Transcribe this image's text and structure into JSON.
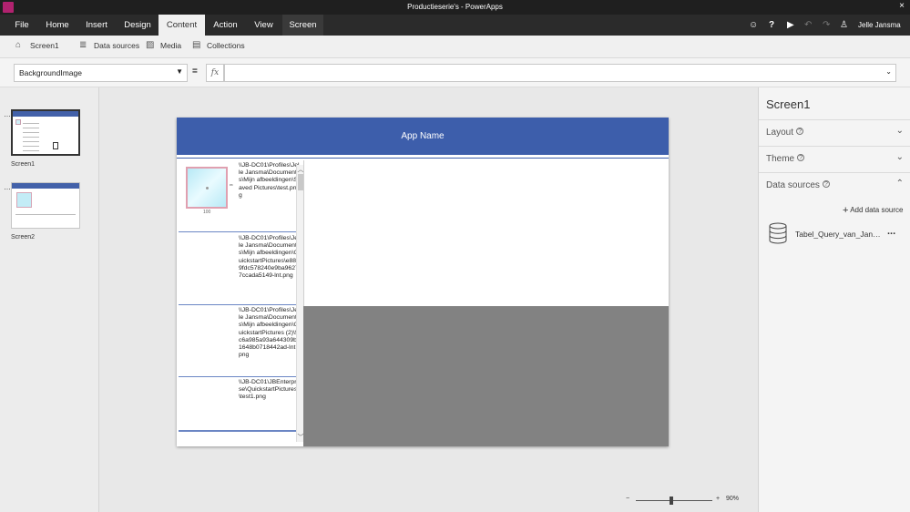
{
  "window": {
    "title": "Productieserie's - PowerApps",
    "close_glyph": "×"
  },
  "menu": {
    "tabs": [
      {
        "label": "File"
      },
      {
        "label": "Home"
      },
      {
        "label": "Insert"
      },
      {
        "label": "Design"
      },
      {
        "label": "Content"
      },
      {
        "label": "Action"
      },
      {
        "label": "View"
      },
      {
        "label": "Screen"
      }
    ],
    "active_tab": "Content",
    "user_name": "Jelle Jansma"
  },
  "subtoolbar": {
    "screen_label": "Screen1",
    "data_sources_label": "Data sources",
    "media_label": "Media",
    "collections_label": "Collections"
  },
  "propbar": {
    "property": "BackgroundImage",
    "equals": "=",
    "fx": "fx",
    "formula": ""
  },
  "screens": [
    {
      "label": "Screen1",
      "selected": true
    },
    {
      "label": "Screen2",
      "selected": false
    }
  ],
  "app": {
    "header_title": "App Name",
    "gallery_items": [
      {
        "path": "\\\\JB-DC01\\Profiles\\Jelle Jansma\\Documents\\Mijn afbeeldingen\\Saved Pictures\\test.png"
      },
      {
        "path": "\\\\JB-DC01\\Profiles\\Jelle Jansma\\Documents\\Mijn afbeeldingen\\QuickstartPictures\\e8809fdc578240e9ba96277ccada5149-lnt.png"
      },
      {
        "path": "\\\\JB-DC01\\Profiles\\Jelle Jansma\\Documents\\Mijn afbeeldingen\\QuickstartPictures (2)\\5c6a985a93a644309b1648b0718442ad-lnt.png"
      },
      {
        "path": "\\\\JB-DC01\\JBEnterprise\\QuickstartPictures\\test1.png"
      }
    ],
    "image_size_label": "100"
  },
  "zoom": {
    "minus": "−",
    "plus": "+",
    "percent": "90%",
    "level": 0.9
  },
  "rightpane": {
    "title": "Screen1",
    "sections": [
      {
        "label": "Layout",
        "expanded": false
      },
      {
        "label": "Theme",
        "expanded": false
      },
      {
        "label": "Data sources",
        "expanded": true
      }
    ],
    "add_data_source": "Add data source",
    "data_source_name": "Tabel_Query_van_Jansm...",
    "more_glyph": "..."
  },
  "colors": {
    "header_blue": "#3d5eab",
    "menubar": "#2b2b2b",
    "app_icon": "#b1226f",
    "preview_gray": "#828282"
  }
}
